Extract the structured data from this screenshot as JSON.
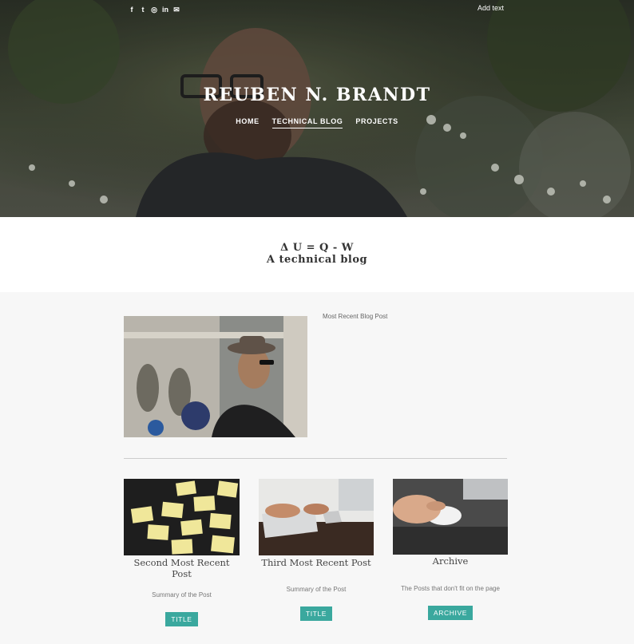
{
  "header": {
    "social_icons": [
      "facebook-icon",
      "twitter-icon",
      "instagram-icon",
      "linkedin-icon",
      "mail-icon"
    ],
    "social_glyphs": [
      "f",
      "t",
      "◎",
      "in",
      "✉"
    ],
    "add_text": "Add text",
    "site_title": "REUBEN N. BRANDT",
    "nav": [
      {
        "label": "HOME"
      },
      {
        "label": "TECHNICAL BLOG",
        "active": true
      },
      {
        "label": "PROJECTS"
      }
    ]
  },
  "tagline": {
    "line1": "Δ U = Q - W",
    "line2": "A technical blog"
  },
  "featured": {
    "label": "Most Recent Blog Post"
  },
  "cards": [
    {
      "title": "Second Most Recent Post",
      "summary": "Summary of the Post",
      "button": "TITLE"
    },
    {
      "title": "Third Most Recent Post",
      "summary": "Summary of the Post",
      "button": "TITLE"
    },
    {
      "title": "Archive",
      "summary": "The Posts that don't fit on the page",
      "button": "ARCHIVE"
    }
  ],
  "colors": {
    "accent": "#3aa89e",
    "page_bg": "#f7f7f7"
  }
}
